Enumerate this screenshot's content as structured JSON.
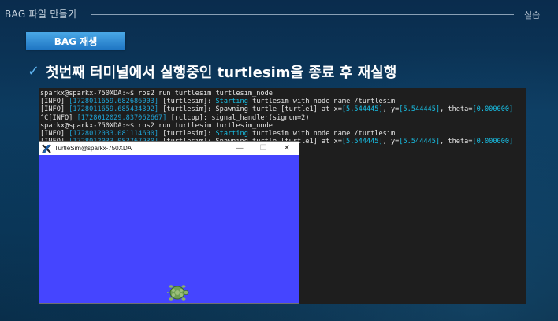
{
  "slide": {
    "doc_title": "BAG 파일 만들기",
    "section": "실습",
    "badge": "BAG 재생",
    "heading": "첫번째 터미널에서 실행중인 turtlesim을 종료 후 재실행"
  },
  "terminal": {
    "lines": [
      [
        {
          "t": "sparkx@sparkx-750XDA:~$ ros2 run turtlesim turtlesim_node",
          "c": ""
        }
      ],
      [
        {
          "t": "[INFO] ",
          "c": ""
        },
        {
          "t": "[1728011659.682686003]",
          "c": "dim"
        },
        {
          "t": " [turtlesim]: ",
          "c": ""
        },
        {
          "t": "Starting",
          "c": "cyan"
        },
        {
          "t": " turtlesim with node name /turtlesim",
          "c": ""
        }
      ],
      [
        {
          "t": "[INFO] ",
          "c": ""
        },
        {
          "t": "[1728011659.685434392]",
          "c": "dim"
        },
        {
          "t": " [turtlesim]: Spawning turtle [turtle1] at x=",
          "c": ""
        },
        {
          "t": "[5.544445]",
          "c": "cyan"
        },
        {
          "t": ", y=",
          "c": ""
        },
        {
          "t": "[5.544445]",
          "c": "cyan"
        },
        {
          "t": ", theta=",
          "c": ""
        },
        {
          "t": "[0.000000]",
          "c": "cyan"
        }
      ],
      [
        {
          "t": "^C[INFO] ",
          "c": ""
        },
        {
          "t": "[1728012029.837062667]",
          "c": "dim"
        },
        {
          "t": " [rclcpp]: signal_handler(signum=2)",
          "c": ""
        }
      ],
      [
        {
          "t": "sparkx@sparkx-750XDA:~$ ros2 run turtlesim turtlesim_node",
          "c": ""
        }
      ],
      [
        {
          "t": "[INFO] ",
          "c": ""
        },
        {
          "t": "[1728012033.081114600]",
          "c": "dim"
        },
        {
          "t": " [turtlesim]: ",
          "c": ""
        },
        {
          "t": "Starting",
          "c": "cyan"
        },
        {
          "t": " turtlesim with node name /turtlesim",
          "c": ""
        }
      ],
      [
        {
          "t": "[INFO] ",
          "c": ""
        },
        {
          "t": "[1728012033.083767930]",
          "c": "dim"
        },
        {
          "t": " [turtlesim]: Spawning turtle [turtle1] at x=",
          "c": ""
        },
        {
          "t": "[5.544445]",
          "c": "cyan"
        },
        {
          "t": ", y=",
          "c": ""
        },
        {
          "t": "[5.544445]",
          "c": "cyan"
        },
        {
          "t": ", theta=",
          "c": ""
        },
        {
          "t": "[0.000000]",
          "c": "cyan"
        }
      ]
    ]
  },
  "turtlesim_window": {
    "title": "TurtleSim@sparkx-750XDA",
    "app_icon": "x-logo-icon",
    "canvas_color": "#4545ff",
    "controls": {
      "minimize": "—",
      "maximize": "☐",
      "close": "✕"
    }
  },
  "colors": {
    "badge": "#2f8fd6",
    "accent_check": "#5fb4f0",
    "terminal_bg": "#1e1e1e",
    "timestamp": "#1fa4d8",
    "highlight": "#18c0e6"
  },
  "icons": {
    "heading_bullet": "✓"
  }
}
